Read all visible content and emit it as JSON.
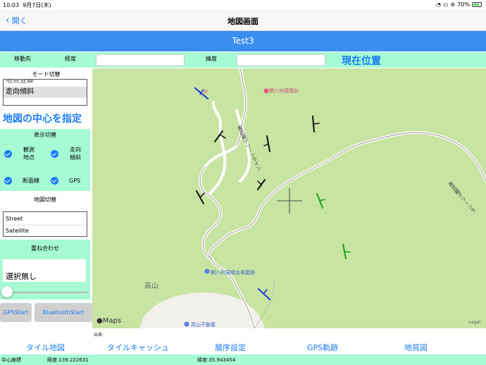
{
  "status": {
    "time": "10:03",
    "date": "9月7日(木)",
    "battery": "70%"
  },
  "nav": {
    "back_label": "開く",
    "title": "地図画面"
  },
  "banner": {
    "title": "Test3"
  },
  "destination": {
    "label": "移動先",
    "lon_label": "経度",
    "lat_label": "緯度",
    "lon_value": "",
    "lat_value": "",
    "current_position": "現在位置"
  },
  "mode": {
    "title": "モード切替",
    "options": [
      "地点登録",
      "走向傾斜"
    ],
    "selected": "走向傾斜"
  },
  "center_button": "地図の中心を指定",
  "display": {
    "title": "表示切替",
    "items": [
      {
        "label": "観測\n地点",
        "checked": true
      },
      {
        "label": "走向\n傾斜",
        "checked": true
      },
      {
        "label": "断面線",
        "checked": true
      },
      {
        "label": "GPS",
        "checked": true
      }
    ]
  },
  "map_switch": {
    "title": "地図切替",
    "options": [
      "Street",
      "Satellite"
    ]
  },
  "overlay": {
    "title": "重ね合わせ",
    "value": "選択無し",
    "slider": 0
  },
  "buttons": {
    "gps_start": "GPSStart",
    "bluetooth_start": "BluetoothStart"
  },
  "map": {
    "labels": {
      "poi1": "関八州見晴台",
      "road1": "奥武蔵グリーンライン",
      "road2": "奥武蔵グリーンラ",
      "poi2": "関八州見晴台茶屋跡",
      "mountain": "高山",
      "poi3": "高山不動尊",
      "brand": "Maps",
      "legal": "Legal",
      "source": "出典:"
    }
  },
  "tabs": [
    "タイル地図",
    "タイルキャッシュ",
    "層序設定",
    "GPS軌跡",
    "地質図"
  ],
  "coords": {
    "center_label": "中心座標",
    "lon": "経度:139.222631",
    "lat": "緯度:35.943454"
  },
  "colors": {
    "accent": "#1a7cf5",
    "mint": "#a6fbd4",
    "banner": "#3a8ef0",
    "map_bg": "#c8e4a2"
  }
}
